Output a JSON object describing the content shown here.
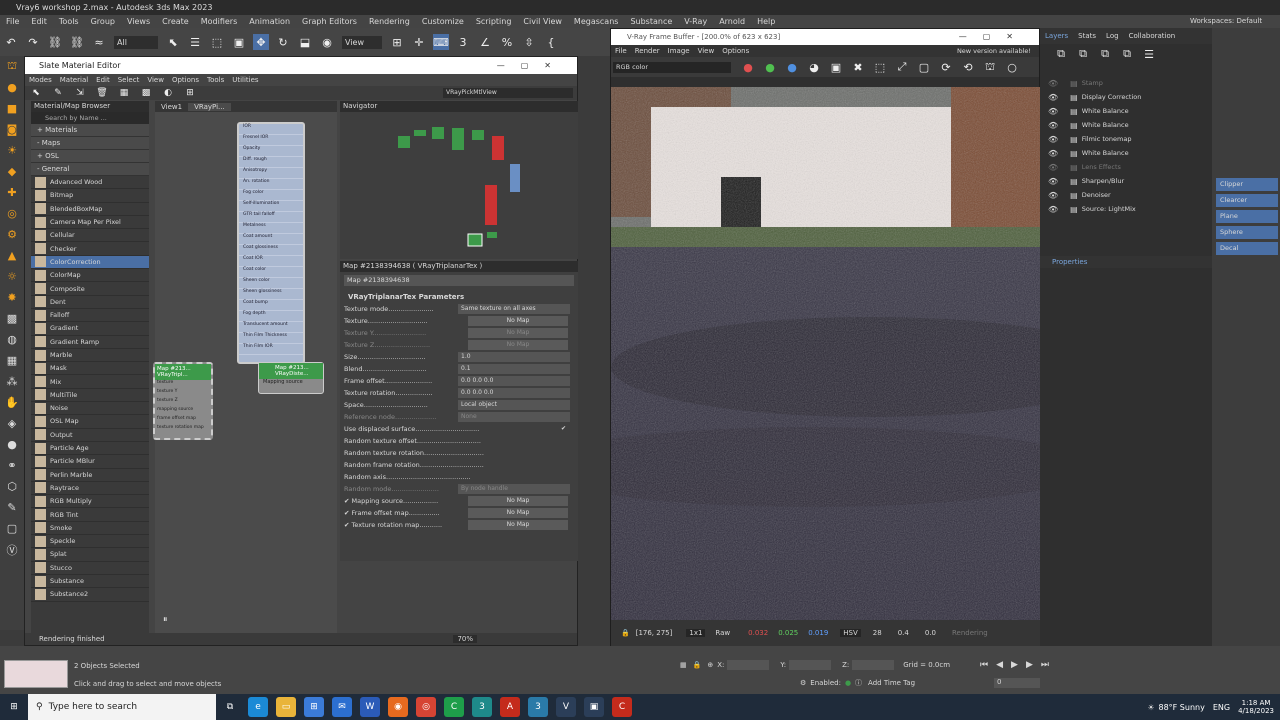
{
  "app_title": "Vray6 workshop 2.max - Autodesk 3ds Max 2023",
  "menu": [
    "File",
    "Edit",
    "Tools",
    "Group",
    "Views",
    "Create",
    "Modifiers",
    "Animation",
    "Graph Editors",
    "Rendering",
    "Customize",
    "Scripting",
    "Civil View",
    "Megascans",
    "Substance",
    "V-Ray",
    "Arnold",
    "Help"
  ],
  "workspaces_label": "Workspaces: Default",
  "toolbar": {
    "filter_value": "All",
    "view_value": "View"
  },
  "slate": {
    "title": "Slate Material Editor",
    "menu": [
      "Modes",
      "Material",
      "Edit",
      "Select",
      "View",
      "Options",
      "Tools",
      "Utilities"
    ],
    "view_dropdown": "VRayPickMtlView",
    "browser_title": "Material/Map Browser",
    "search_placeholder": "Search by Name ...",
    "sections": [
      "+ Materials",
      "- Maps",
      "+ OSL",
      "- General"
    ],
    "map_items": [
      "Advanced Wood",
      "Bitmap",
      "BlendedBoxMap",
      "Camera Map Per Pixel",
      "Cellular",
      "Checker",
      "ColorCorrection",
      "ColorMap",
      "Composite",
      "Dent",
      "Falloff",
      "Gradient",
      "Gradient Ramp",
      "Marble",
      "Mask",
      "Mix",
      "MultiTile",
      "Noise",
      "OSL Map",
      "Output",
      "Particle Age",
      "Particle MBlur",
      "Perlin Marble",
      "Raytrace",
      "RGB Multiply",
      "RGB Tint",
      "Smoke",
      "Speckle",
      "Splat",
      "Stucco",
      "Substance",
      "Substance2"
    ],
    "selected_item": "ColorCorrection",
    "view_tabs": [
      "View1",
      "VRayPi..."
    ],
    "navigator_title": "Navigator",
    "node_slots": [
      "IOR",
      "Fresnel IOR",
      "Opacity",
      "Diff. rough",
      "Anisotropy",
      "An. rotation",
      "Fog color",
      "Self-illumination",
      "GTR tail falloff",
      "Metalness",
      "Coat amount",
      "Coat glossiness",
      "Coat IOR",
      "Coat color",
      "Sheen color",
      "Sheen glossiness",
      "Coat bump",
      "Fog depth",
      "Translucent amount",
      "Thin Film Thickness",
      "Thin Film IOR"
    ],
    "node1_title": "Map #213... VRayTripl...",
    "node1_slots": [
      "texture",
      "texture Y",
      "texture Z",
      "mapping source",
      "frame offset map",
      "texture rotation map"
    ],
    "node2_title": "Map #213... VRayDiste...",
    "node2_slot": "Mapping source",
    "zoom": "70%",
    "status": "Rendering finished"
  },
  "params": {
    "header": "Map #2138394638  ( VRayTriplanarTex )",
    "name": "Map #2138394638",
    "rollout": "VRayTriplanarTex Parameters",
    "rows": [
      {
        "label": "Texture mode......................",
        "value": "Same texture on all axes",
        "dim": false
      },
      {
        "label": "Texture.............................",
        "value": "No Map",
        "dim": false
      },
      {
        "label": "Texture Y..........................",
        "value": "No Map",
        "dim": true
      },
      {
        "label": "Texture Z...........................",
        "value": "No Map",
        "dim": true
      },
      {
        "label": "Size.................................",
        "value": "1.0",
        "dim": false
      },
      {
        "label": "Blend...............................",
        "value": "0.1",
        "dim": false
      },
      {
        "label": "Frame offset.......................",
        "value": "0.0     0.0     0.0",
        "dim": false
      },
      {
        "label": "Texture rotation..................",
        "value": "0.0     0.0     0.0",
        "dim": false
      },
      {
        "label": "Space...............................",
        "value": "Local object",
        "dim": false
      },
      {
        "label": "Reference node....................",
        "value": "None",
        "dim": true
      },
      {
        "label": "Use displaced surface...............................",
        "value": "✔",
        "dim": false
      },
      {
        "label": "Random texture offset...............................",
        "value": "",
        "dim": false
      },
      {
        "label": "Random texture rotation.............................",
        "value": "",
        "dim": false
      },
      {
        "label": "Random frame rotation...............................",
        "value": "",
        "dim": false
      },
      {
        "label": "Random axis.........................................",
        "value": "",
        "dim": false
      },
      {
        "label": "Random mode.......................",
        "value": "By node handle",
        "dim": true
      },
      {
        "label": "✔  Mapping source.................",
        "value": "No Map",
        "dim": false
      },
      {
        "label": "✔  Frame offset map...............",
        "value": "No Map",
        "dim": false
      },
      {
        "label": "✔  Texture rotation map...........",
        "value": "No Map",
        "dim": false
      }
    ]
  },
  "vfb": {
    "title": "V-Ray Frame Buffer - [200.0% of 623 x 623]",
    "menu": [
      "File",
      "Render",
      "Image",
      "View",
      "Options"
    ],
    "notice": "New version available!",
    "channel": "RGB color",
    "coords": "[176, 275]",
    "zoom": "1x1",
    "raw": "Raw",
    "r": "0.032",
    "g": "0.025",
    "b": "0.019",
    "mode": "HSV",
    "h": "28",
    "s": "0.4",
    "v": "0.0",
    "render_state": "Rendering"
  },
  "layers": {
    "tabs": [
      "Layers",
      "Stats",
      "Log",
      "Collaboration"
    ],
    "items": [
      {
        "label": "Stamp",
        "dim": true
      },
      {
        "label": "Display Correction",
        "dim": false
      },
      {
        "label": "White Balance",
        "dim": false
      },
      {
        "label": "White Balance",
        "dim": false
      },
      {
        "label": "Filmic tonemap",
        "dim": false
      },
      {
        "label": "White Balance",
        "dim": false
      },
      {
        "label": "Lens Effects",
        "dim": true
      },
      {
        "label": "Sharpen/Blur",
        "dim": false
      },
      {
        "label": "Denoiser",
        "dim": false
      },
      {
        "label": "Source: LightMix",
        "dim": false
      }
    ],
    "properties": "Properties"
  },
  "right_items": [
    "Clipper",
    "Clearcer",
    "Plane",
    "Sphere",
    "Decal"
  ],
  "status": {
    "selection": "2 Objects Selected",
    "hint": "Click and drag to select and move objects",
    "grid": "Grid = 0.0cm",
    "add_time_tag": "Add Time Tag",
    "enabled": "Enabled:",
    "frame": "0"
  },
  "taskbar": {
    "search_placeholder": "Type here to search",
    "weather": "88°F  Sunny",
    "lang": "ENG",
    "time": "1:18 AM",
    "date": "4/18/2023"
  },
  "colors": {
    "accent": "#4a6fa5",
    "node_green": "#3d9a4a",
    "orange": "#f0a020"
  }
}
